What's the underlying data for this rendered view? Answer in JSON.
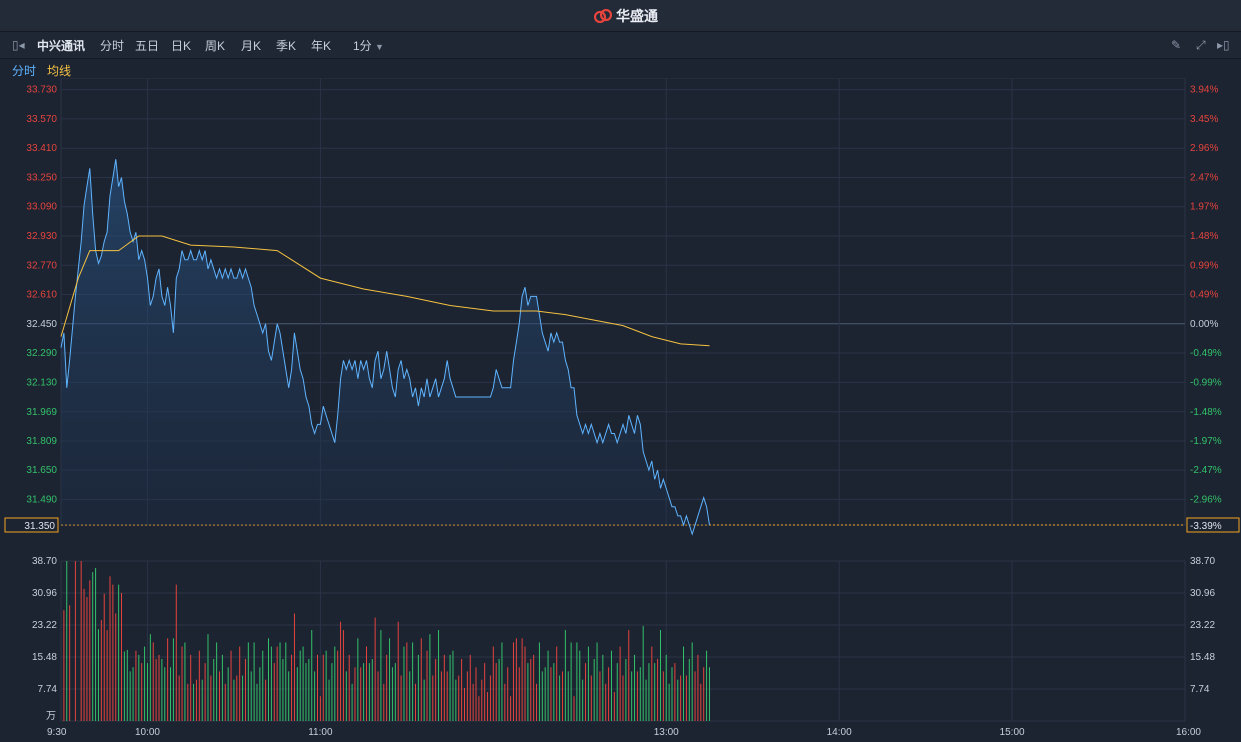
{
  "header": {
    "brand": "华盛通"
  },
  "toolbar": {
    "stock_name": "中兴通讯",
    "periods": [
      "分时",
      "五日",
      "日K",
      "周K",
      "月K",
      "季K",
      "年K"
    ],
    "active_period": "分时",
    "interval": "1分"
  },
  "legend": {
    "price_label": "分时",
    "avg_label": "均线"
  },
  "colors": {
    "price_line": "#5fb4ff",
    "avg_line": "#f5c242",
    "up": "#e5443d",
    "down": "#33c26a",
    "grid": "#2b3447",
    "current": "#f5a623"
  },
  "chart_data": {
    "type": "line",
    "prev_close": 32.45,
    "current_price": "31.350",
    "current_pct": "-3.39%",
    "price_ticks": [
      "33.730",
      "33.570",
      "33.410",
      "33.250",
      "33.090",
      "32.930",
      "32.770",
      "32.610",
      "32.450",
      "32.290",
      "32.130",
      "31.969",
      "31.809",
      "31.650",
      "31.490"
    ],
    "pct_ticks": [
      "3.94%",
      "3.45%",
      "2.96%",
      "2.47%",
      "1.97%",
      "1.48%",
      "0.99%",
      "0.49%",
      "0.00%",
      "-0.49%",
      "-0.99%",
      "-1.48%",
      "-1.97%",
      "-2.47%",
      "-2.96%"
    ],
    "price_ylim": [
      31.35,
      33.75
    ],
    "time_ticks": [
      "9:30",
      "10:00",
      "11:00",
      "13:00",
      "14:00",
      "15:00",
      "16:00"
    ],
    "time_tick_minutes": [
      0,
      30,
      90,
      210,
      270,
      330,
      390
    ],
    "xlim": [
      0,
      390
    ],
    "price": [
      [
        0,
        32.32
      ],
      [
        1,
        32.4
      ],
      [
        2,
        32.1
      ],
      [
        3,
        32.25
      ],
      [
        5,
        32.6
      ],
      [
        7,
        32.9
      ],
      [
        8,
        33.1
      ],
      [
        9,
        33.2
      ],
      [
        10,
        33.3
      ],
      [
        11,
        33.05
      ],
      [
        12,
        32.85
      ],
      [
        13,
        32.78
      ],
      [
        14,
        32.82
      ],
      [
        15,
        32.9
      ],
      [
        16,
        32.95
      ],
      [
        17,
        33.15
      ],
      [
        18,
        33.25
      ],
      [
        19,
        33.35
      ],
      [
        20,
        33.2
      ],
      [
        21,
        33.25
      ],
      [
        22,
        33.12
      ],
      [
        23,
        33.05
      ],
      [
        24,
        32.95
      ],
      [
        25,
        32.9
      ],
      [
        26,
        32.95
      ],
      [
        27,
        32.8
      ],
      [
        28,
        32.85
      ],
      [
        29,
        32.8
      ],
      [
        30,
        32.7
      ],
      [
        31,
        32.55
      ],
      [
        32,
        32.6
      ],
      [
        33,
        32.7
      ],
      [
        34,
        32.75
      ],
      [
        35,
        32.6
      ],
      [
        36,
        32.55
      ],
      [
        37,
        32.65
      ],
      [
        38,
        32.55
      ],
      [
        39,
        32.4
      ],
      [
        40,
        32.7
      ],
      [
        41,
        32.75
      ],
      [
        42,
        32.85
      ],
      [
        43,
        32.8
      ],
      [
        44,
        32.8
      ],
      [
        45,
        32.85
      ],
      [
        46,
        32.8
      ],
      [
        47,
        32.8
      ],
      [
        48,
        32.85
      ],
      [
        49,
        32.8
      ],
      [
        50,
        32.85
      ],
      [
        51,
        32.75
      ],
      [
        52,
        32.8
      ],
      [
        53,
        32.75
      ],
      [
        54,
        32.7
      ],
      [
        55,
        32.75
      ],
      [
        56,
        32.7
      ],
      [
        57,
        32.75
      ],
      [
        58,
        32.7
      ],
      [
        59,
        32.75
      ],
      [
        60,
        32.7
      ],
      [
        61,
        32.7
      ],
      [
        62,
        32.75
      ],
      [
        63,
        32.7
      ],
      [
        64,
        32.75
      ],
      [
        65,
        32.7
      ],
      [
        66,
        32.65
      ],
      [
        67,
        32.55
      ],
      [
        68,
        32.5
      ],
      [
        69,
        32.45
      ],
      [
        70,
        32.4
      ],
      [
        71,
        32.45
      ],
      [
        72,
        32.3
      ],
      [
        73,
        32.25
      ],
      [
        74,
        32.35
      ],
      [
        75,
        32.45
      ],
      [
        76,
        32.4
      ],
      [
        77,
        32.3
      ],
      [
        78,
        32.2
      ],
      [
        79,
        32.1
      ],
      [
        80,
        32.2
      ],
      [
        81,
        32.4
      ],
      [
        82,
        32.3
      ],
      [
        83,
        32.2
      ],
      [
        84,
        32.15
      ],
      [
        85,
        32.05
      ],
      [
        86,
        32.0
      ],
      [
        87,
        31.9
      ],
      [
        88,
        31.85
      ],
      [
        89,
        31.9
      ],
      [
        90,
        31.9
      ],
      [
        91,
        32.0
      ],
      [
        92,
        31.95
      ],
      [
        93,
        31.9
      ],
      [
        94,
        31.85
      ],
      [
        95,
        31.8
      ],
      [
        96,
        31.95
      ],
      [
        97,
        32.15
      ],
      [
        98,
        32.25
      ],
      [
        99,
        32.2
      ],
      [
        100,
        32.25
      ],
      [
        101,
        32.2
      ],
      [
        102,
        32.25
      ],
      [
        103,
        32.15
      ],
      [
        104,
        32.25
      ],
      [
        105,
        32.2
      ],
      [
        106,
        32.25
      ],
      [
        107,
        32.15
      ],
      [
        108,
        32.1
      ],
      [
        109,
        32.25
      ],
      [
        110,
        32.3
      ],
      [
        111,
        32.15
      ],
      [
        112,
        32.2
      ],
      [
        113,
        32.3
      ],
      [
        114,
        32.2
      ],
      [
        115,
        32.1
      ],
      [
        116,
        32.05
      ],
      [
        117,
        32.2
      ],
      [
        118,
        32.25
      ],
      [
        119,
        32.15
      ],
      [
        120,
        32.2
      ],
      [
        121,
        32.15
      ],
      [
        122,
        32.05
      ],
      [
        123,
        32.1
      ],
      [
        124,
        32.0
      ],
      [
        125,
        32.1
      ],
      [
        126,
        32.05
      ],
      [
        127,
        32.15
      ],
      [
        128,
        32.05
      ],
      [
        129,
        32.1
      ],
      [
        130,
        32.15
      ],
      [
        131,
        32.05
      ],
      [
        132,
        32.1
      ],
      [
        133,
        32.15
      ],
      [
        134,
        32.25
      ],
      [
        135,
        32.15
      ],
      [
        136,
        32.1
      ],
      [
        137,
        32.05
      ],
      [
        138,
        32.05
      ],
      [
        139,
        32.05
      ],
      [
        140,
        32.05
      ],
      [
        141,
        32.05
      ],
      [
        142,
        32.05
      ],
      [
        143,
        32.05
      ],
      [
        144,
        32.05
      ],
      [
        145,
        32.05
      ],
      [
        146,
        32.05
      ],
      [
        147,
        32.05
      ],
      [
        148,
        32.05
      ],
      [
        149,
        32.05
      ],
      [
        150,
        32.1
      ],
      [
        151,
        32.2
      ],
      [
        152,
        32.15
      ],
      [
        153,
        32.1
      ],
      [
        154,
        32.1
      ],
      [
        155,
        32.1
      ],
      [
        156,
        32.1
      ],
      [
        157,
        32.25
      ],
      [
        158,
        32.35
      ],
      [
        159,
        32.45
      ],
      [
        160,
        32.6
      ],
      [
        161,
        32.65
      ],
      [
        162,
        32.55
      ],
      [
        163,
        32.6
      ],
      [
        164,
        32.6
      ],
      [
        165,
        32.6
      ],
      [
        166,
        32.5
      ],
      [
        167,
        32.4
      ],
      [
        168,
        32.35
      ],
      [
        169,
        32.3
      ],
      [
        170,
        32.4
      ],
      [
        171,
        32.35
      ],
      [
        172,
        32.4
      ],
      [
        173,
        32.35
      ],
      [
        174,
        32.35
      ],
      [
        175,
        32.25
      ],
      [
        176,
        32.2
      ],
      [
        177,
        32.1
      ],
      [
        178,
        32.1
      ],
      [
        179,
        31.95
      ],
      [
        180,
        31.9
      ],
      [
        181,
        31.85
      ],
      [
        182,
        31.9
      ],
      [
        183,
        31.85
      ],
      [
        184,
        31.9
      ],
      [
        185,
        31.85
      ],
      [
        186,
        31.8
      ],
      [
        187,
        31.85
      ],
      [
        188,
        31.8
      ],
      [
        189,
        31.85
      ],
      [
        190,
        31.9
      ],
      [
        191,
        31.85
      ],
      [
        192,
        31.85
      ],
      [
        193,
        31.8
      ],
      [
        194,
        31.85
      ],
      [
        195,
        31.9
      ],
      [
        196,
        31.85
      ],
      [
        197,
        31.95
      ],
      [
        198,
        31.9
      ],
      [
        199,
        31.85
      ],
      [
        200,
        31.95
      ],
      [
        201,
        31.9
      ],
      [
        202,
        31.75
      ],
      [
        203,
        31.7
      ],
      [
        204,
        31.65
      ],
      [
        205,
        31.7
      ],
      [
        206,
        31.6
      ],
      [
        207,
        31.65
      ],
      [
        208,
        31.55
      ],
      [
        209,
        31.6
      ],
      [
        210,
        31.55
      ],
      [
        211,
        31.5
      ],
      [
        212,
        31.45
      ],
      [
        213,
        31.45
      ],
      [
        214,
        31.4
      ],
      [
        215,
        31.4
      ],
      [
        216,
        31.35
      ],
      [
        217,
        31.4
      ],
      [
        218,
        31.35
      ],
      [
        219,
        31.3
      ],
      [
        220,
        31.35
      ],
      [
        221,
        31.4
      ],
      [
        222,
        31.45
      ],
      [
        223,
        31.5
      ],
      [
        224,
        31.45
      ],
      [
        225,
        31.35
      ]
    ],
    "avg": [
      [
        0,
        32.38
      ],
      [
        6,
        32.7
      ],
      [
        10,
        32.85
      ],
      [
        20,
        32.85
      ],
      [
        27,
        32.93
      ],
      [
        35,
        32.93
      ],
      [
        45,
        32.88
      ],
      [
        60,
        32.87
      ],
      [
        75,
        32.85
      ],
      [
        90,
        32.7
      ],
      [
        105,
        32.64
      ],
      [
        120,
        32.6
      ],
      [
        135,
        32.55
      ],
      [
        150,
        32.52
      ],
      [
        165,
        32.52
      ],
      [
        175,
        32.5
      ],
      [
        185,
        32.47
      ],
      [
        195,
        32.44
      ],
      [
        205,
        32.38
      ],
      [
        215,
        32.34
      ],
      [
        225,
        32.33
      ]
    ],
    "volume_ticks": [
      "38.70",
      "30.96",
      "23.22",
      "15.48",
      "7.74"
    ],
    "volume_unit": "万",
    "volume_ylim": [
      0,
      38.7
    ]
  }
}
